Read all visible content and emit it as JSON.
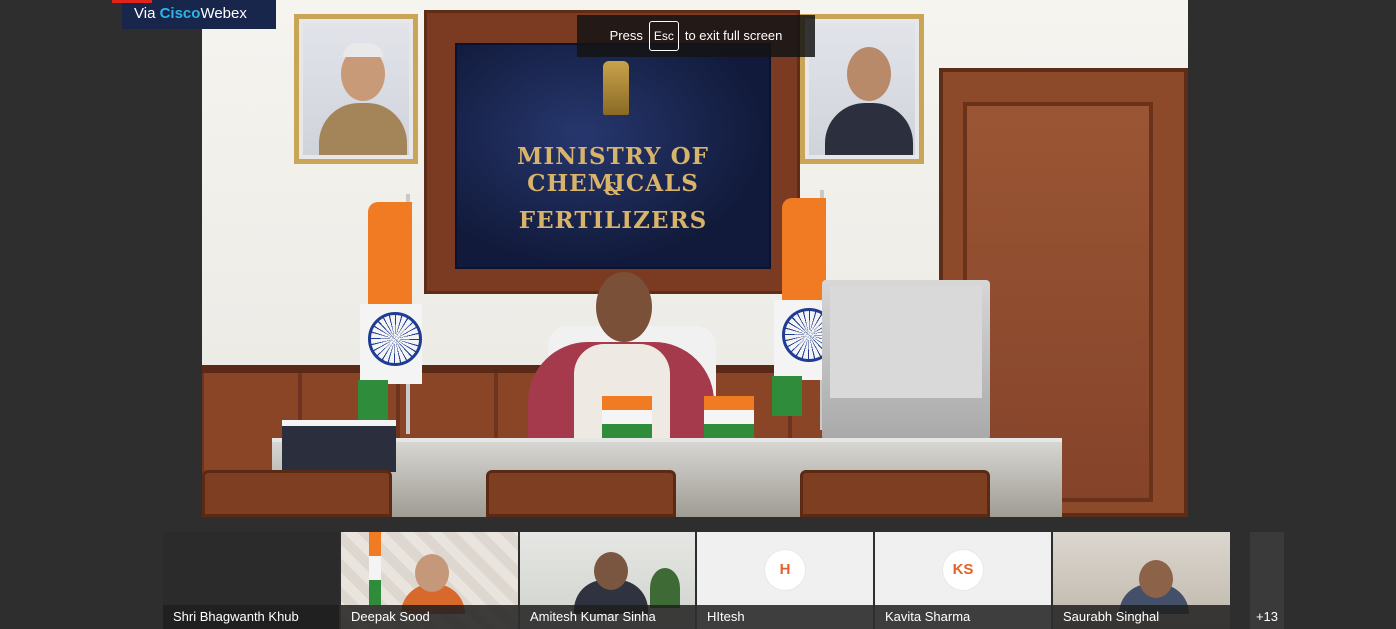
{
  "badge": {
    "prefix": "Via ",
    "brand_a": "Cisco",
    "brand_b": "Webex"
  },
  "fullscreen_hint": {
    "press": "Press",
    "key": "Esc",
    "suffix": "to exit full screen"
  },
  "main_video": {
    "board_line1": "MINISTRY OF CHEMICALS",
    "board_line2": "&",
    "board_line3": "FERTILIZERS"
  },
  "participants": [
    {
      "name": "Shri Bhagwanth Khub",
      "type": "no-video"
    },
    {
      "name": "Deepak Sood",
      "type": "video"
    },
    {
      "name": "Amitesh Kumar Sinha",
      "type": "video"
    },
    {
      "name": "HItesh",
      "type": "avatar",
      "initials": "H"
    },
    {
      "name": "Kavita Sharma",
      "type": "avatar",
      "initials": "KS"
    },
    {
      "name": "Saurabh Singhal",
      "type": "video"
    }
  ],
  "more_participants": "+13",
  "colors": {
    "background": "#2e2e2e",
    "webex_badge": "#17264a",
    "webex_accent": "#2cb5e8",
    "avatar_initials": "#e3622c"
  }
}
